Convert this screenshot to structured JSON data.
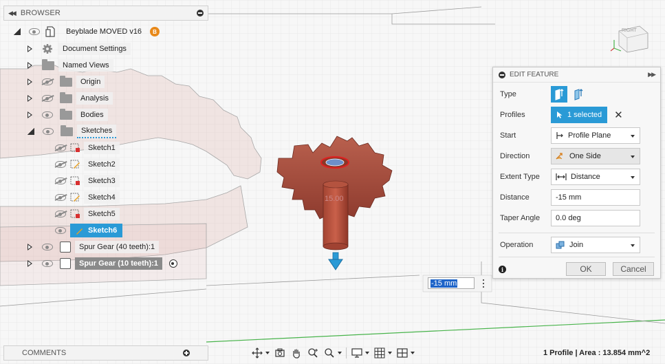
{
  "browser": {
    "title": "BROWSER",
    "root": {
      "label": "Beyblade MOVED v16",
      "badge": "B"
    },
    "items": [
      {
        "label": "Document Settings"
      },
      {
        "label": "Named Views"
      },
      {
        "label": "Origin"
      },
      {
        "label": "Analysis"
      },
      {
        "label": "Bodies"
      },
      {
        "label": "Sketches"
      }
    ],
    "sketches": [
      "Sketch1",
      "Sketch2",
      "Sketch3",
      "Sketch4",
      "Sketch5",
      "Sketch6"
    ],
    "components": [
      {
        "label": "Spur Gear (40 teeth):1"
      },
      {
        "label": "Spur Gear (10 teeth):1"
      }
    ]
  },
  "edit_feature": {
    "title": "EDIT FEATURE",
    "type_label": "Type",
    "profiles_label": "Profiles",
    "profiles_value": "1 selected",
    "start_label": "Start",
    "start_value": "Profile Plane",
    "direction_label": "Direction",
    "direction_value": "One Side",
    "extent_label": "Extent Type",
    "extent_value": "Distance",
    "distance_label": "Distance",
    "distance_value": "-15 mm",
    "taper_label": "Taper Angle",
    "taper_value": "0.0 deg",
    "operation_label": "Operation",
    "operation_value": "Join",
    "ok_label": "OK",
    "cancel_label": "Cancel"
  },
  "viewport": {
    "dimension_input": "-15 mm",
    "dimension_label": "15.00",
    "viewcube_label": "RIGHT"
  },
  "comments": {
    "title": "COMMENTS"
  },
  "status": {
    "text": "1 Profile | Area : 13.854 mm^2"
  },
  "colors": {
    "accent": "#2a9ad6",
    "gear_body": "#a0493a",
    "selection": "#1e64c8"
  }
}
